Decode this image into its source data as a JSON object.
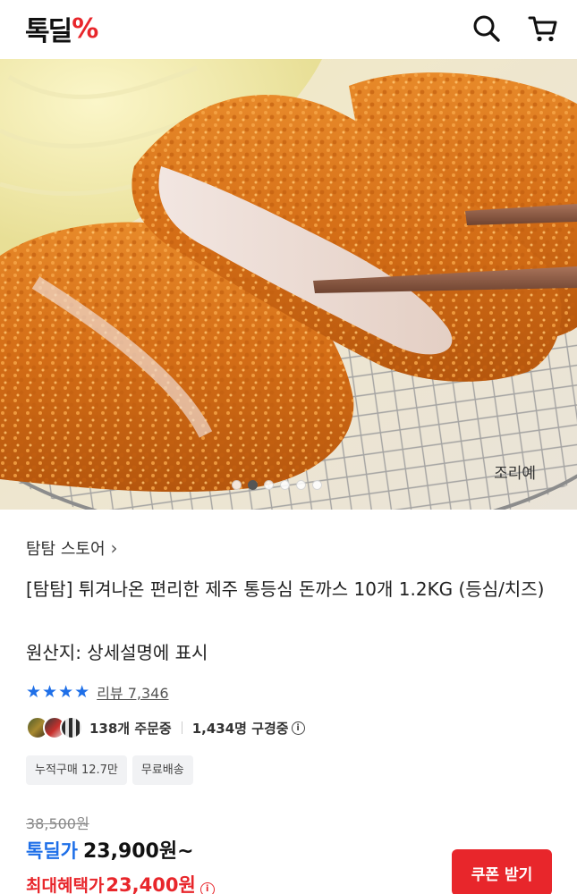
{
  "header": {
    "logo_text": "톡딜",
    "logo_pct": "%",
    "search_icon": "search-icon",
    "cart_icon": "cart-icon"
  },
  "hero": {
    "caption": "조리예",
    "slide_count": 6,
    "active_slide": 1
  },
  "product": {
    "store": "탐탐 스토어",
    "title": "[탐탐] 튀겨나온 편리한 제주 통등심 돈까스 10개 1.2KG (등심/치즈)",
    "origin": "원산지: 상세설명에 표시",
    "rating_stars": 4,
    "review_label": "리뷰 7,346",
    "orders_text": "138개 주문중",
    "viewers_text": "1,434명 구경중",
    "tags": [
      "누적구매 12.7만",
      "무료배송"
    ],
    "original_price": "38,500원",
    "deal_label": "톡딜가",
    "deal_price": "23,900원~",
    "max_label": "최대혜택가",
    "max_price": "23,400원",
    "coupon_button": "쿠폰 받기"
  },
  "colors": {
    "brand_red": "#e8262b",
    "accent_blue": "#1e6fe8"
  }
}
